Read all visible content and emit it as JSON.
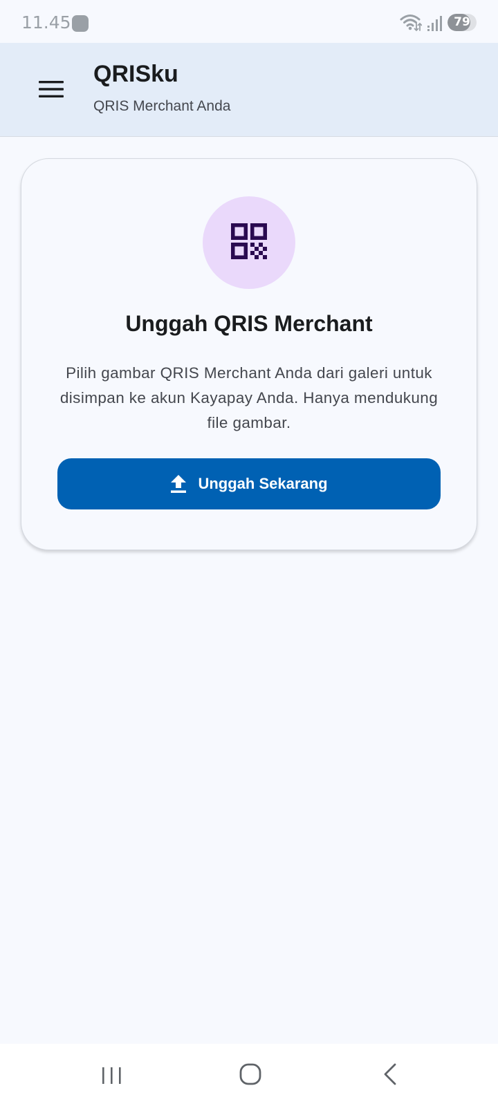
{
  "status_bar": {
    "time": "11.45",
    "battery": "79",
    "battery_level": 0.79,
    "icons": [
      "notification-dot-icon",
      "wifi-icon",
      "signal-icon",
      "battery-icon"
    ]
  },
  "app_bar": {
    "title": "QRISku",
    "subtitle": "QRIS Merchant Anda",
    "menu_icon": "menu-icon"
  },
  "card": {
    "icon": "qr-code-icon",
    "title": "Unggah QRIS Merchant",
    "description": "Pilih gambar QRIS Merchant Anda dari galeri untuk disimpan ke akun Kayapay Anda. Hanya mendukung file gambar.",
    "button_icon": "upload-icon",
    "button_label": "Unggah Sekarang"
  },
  "nav_bar": {
    "icons": [
      "recents-icon",
      "home-icon",
      "back-icon"
    ]
  },
  "colors": {
    "background": "#f7f9fe",
    "app_bar": "#e3ecf8",
    "primary_button": "#0061b3",
    "icon_circle": "#ead9fb",
    "qr_icon": "#2a0a50"
  }
}
